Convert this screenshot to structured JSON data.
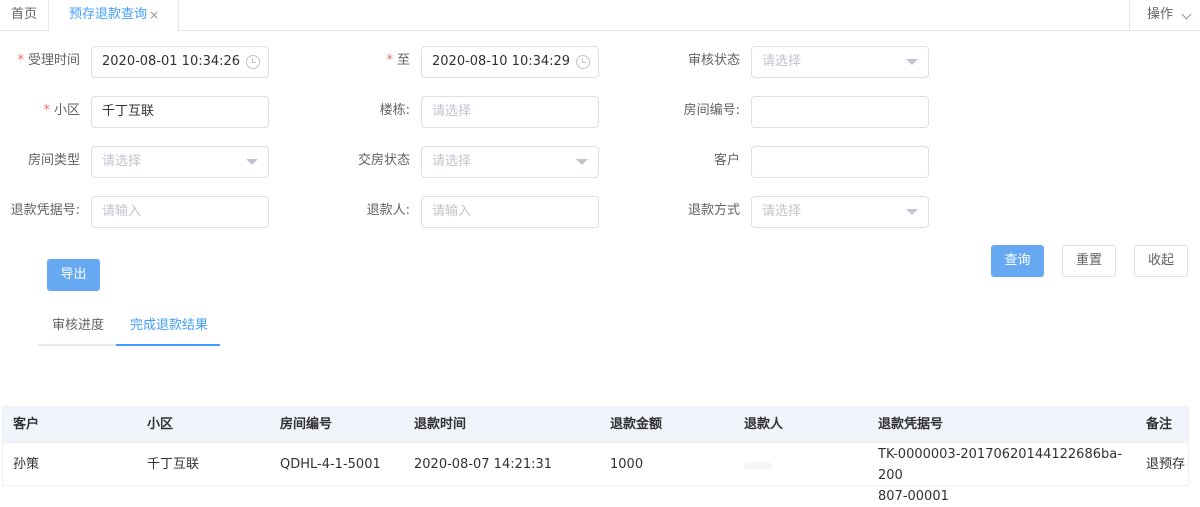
{
  "tabs": {
    "home": "首页",
    "active": "预存退款查询",
    "close": "×",
    "ops": "操作"
  },
  "form": {
    "accept_time_label": "受理时间",
    "accept_time_value": "2020-08-01 10:34:26",
    "to_label": "至",
    "to_value": "2020-08-10 10:34:29",
    "audit_status_label": "审核状态",
    "audit_status_placeholder": "请选择",
    "community_label": "小区",
    "community_value": "千丁互联",
    "building_label": "楼栋:",
    "building_placeholder": "请选择",
    "room_no_label": "房间编号:",
    "room_no_value": "",
    "room_type_label": "房间类型",
    "room_type_placeholder": "请选择",
    "handover_label": "交房状态",
    "handover_placeholder": "请选择",
    "customer_label": "客户",
    "customer_value": "",
    "voucher_label": "退款凭据号:",
    "voucher_placeholder": "请输入",
    "refunder_label": "退款人:",
    "refunder_placeholder": "请输入",
    "method_label": "退款方式",
    "method_placeholder": "请选择",
    "required_mark": "*"
  },
  "buttons": {
    "export": "导出",
    "query": "查询",
    "reset": "重置",
    "collapse": "收起"
  },
  "subtabs": [
    "审核进度",
    "完成退款结果"
  ],
  "table": {
    "headers": [
      "客户",
      "小区",
      "房间编号",
      "退款时间",
      "退款金额",
      "退款人",
      "退款凭据号",
      "备注"
    ],
    "rows": [
      {
        "customer": "孙策",
        "community": "千丁互联",
        "room": "QDHL-4-1-5001",
        "time": "2020-08-07 14:21:31",
        "amount": "1000",
        "refunder": "",
        "voucher": "TK-0000003-20170620144122686ba-200807-00001",
        "voucher_line1": "TK-0000003-20170620144122686ba-200",
        "voucher_line2": "807-00001",
        "remark": "退预存"
      }
    ]
  },
  "colors": {
    "accent": "#409eff",
    "primary_button": "#66a9f2",
    "required": "#f56c6c",
    "header_bg": "#f1f5fb"
  }
}
